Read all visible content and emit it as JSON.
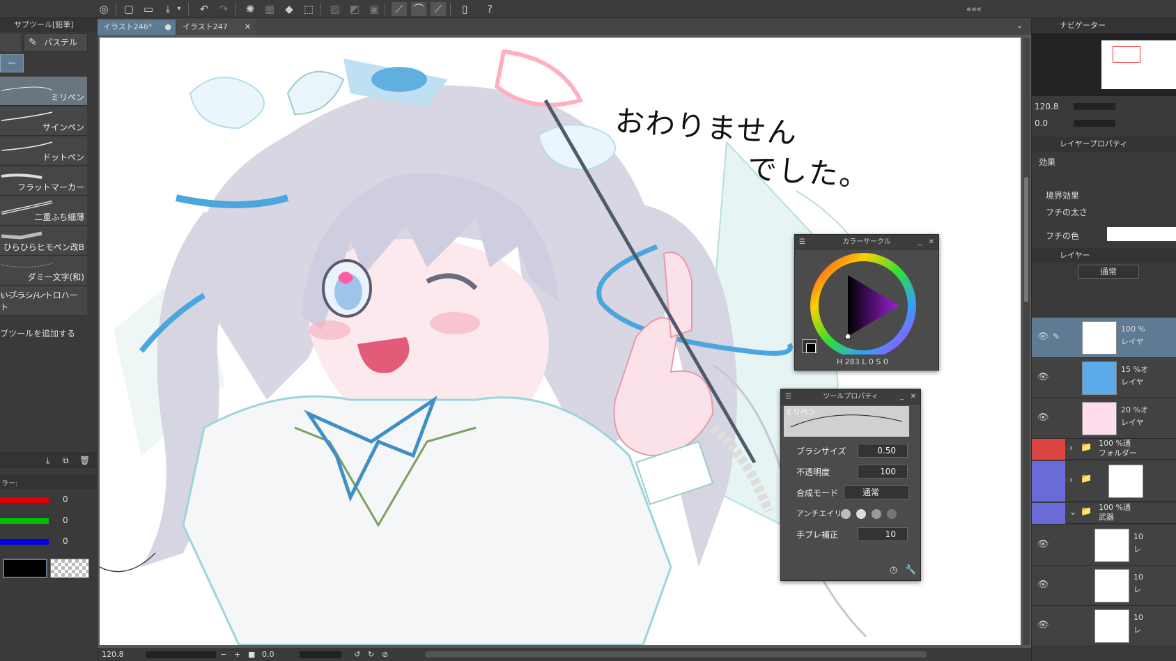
{
  "toolbar": {
    "icons": [
      "clip-logo-icon",
      "new-file-icon",
      "open-folder-icon",
      "save-icon",
      "undo-icon",
      "redo-icon",
      "loading-icon",
      "fill-icon",
      "transform-icon",
      "snap-off-icon",
      "ruler-icon",
      "grid-icon",
      "pen-pressure-icon",
      "pen-tilt-icon",
      "stabilizer-icon",
      "smartphone-icon",
      "help-icon"
    ]
  },
  "subtool": {
    "header": "サブツール[鉛筆]",
    "tab_label": "パステル",
    "brushes": [
      "ミリペン",
      "サインペン",
      "ドットペン",
      "フラットマーカー",
      "二重ふち細薄",
      "ひらひらヒモペン改B",
      "ダミー文字(和)",
      "いブラシ/レトロハート"
    ],
    "add_label": "ブツールを追加する"
  },
  "color": {
    "header": "ラー:",
    "r": "0",
    "g": "0",
    "b": "0"
  },
  "tabs": [
    {
      "label": "イラスト246*"
    },
    {
      "label": "イラスト247"
    }
  ],
  "status": {
    "zoom": "120.8",
    "angle": "0.0"
  },
  "navigator": {
    "title": "ナビゲーター",
    "zoom": "120.8",
    "angle": "0.0"
  },
  "layer_props": {
    "title": "レイヤープロパティ",
    "effect_label": "効果",
    "border_effect": "境界効果",
    "border_width": "フチの太さ",
    "border_color": "フチの色"
  },
  "layers": {
    "title": "レイヤー",
    "blend_mode": "通常",
    "items": [
      {
        "pct": "100 %",
        "name": "レイヤ"
      },
      {
        "pct": "15 %オ",
        "name": "レイヤ"
      },
      {
        "pct": "20 %オ",
        "name": "レイヤ"
      },
      {
        "pct": "100 %通",
        "name": "フォルダー"
      },
      {
        "pct": "",
        "name": ""
      },
      {
        "pct": "100 %通",
        "name": "武器"
      },
      {
        "pct": "10",
        "name": "レ"
      },
      {
        "pct": "10",
        "name": "レ"
      },
      {
        "pct": "10",
        "name": "レ"
      }
    ]
  },
  "canvas_text": {
    "line1": "おわりませんでした。",
    "line1a": "おわりません",
    "line1b": "でした。"
  },
  "color_circle": {
    "title": "カラーサークル",
    "hsv": "H 283 L 0 S 0 0",
    "h": "283",
    "s": "0",
    "v": "0"
  },
  "tool_props": {
    "title": "ツールプロパティ",
    "preset": "ミリペン",
    "brush_size_label": "ブラシサイズ",
    "brush_size": "0.50",
    "opacity_label": "不透明度",
    "opacity": "100",
    "blend_label": "合成モード",
    "blend": "通常",
    "aa_label": "アンチエイリ",
    "stab_label": "手ブレ補正",
    "stab": "10"
  }
}
